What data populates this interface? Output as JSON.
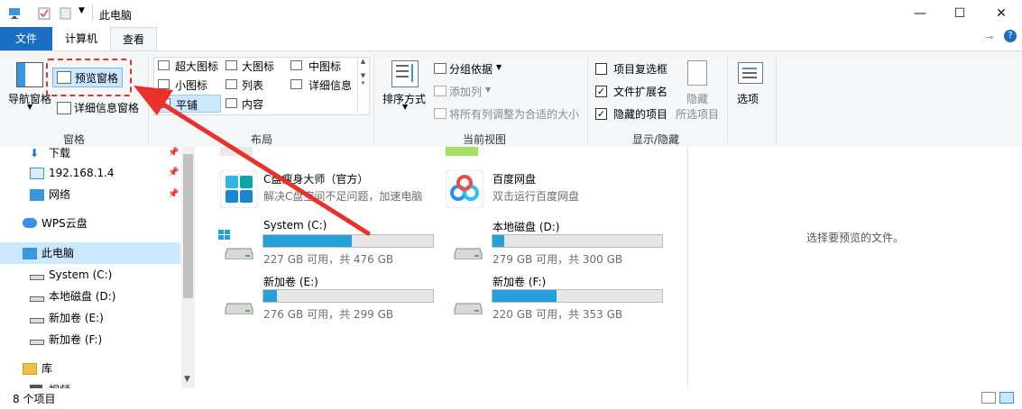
{
  "titlebar": {
    "title": "此电脑"
  },
  "tabs": {
    "file": "文件",
    "computer": "计算机",
    "view": "查看"
  },
  "ribbon": {
    "panes": {
      "nav_pane": "导航窗格",
      "preview_pane": "预览窗格",
      "details_pane": "详细信息窗格",
      "group": "窗格"
    },
    "layout": {
      "extra_large": "超大图标",
      "large": "大图标",
      "medium": "中图标",
      "small": "小图标",
      "list": "列表",
      "details": "详细信息",
      "tiles": "平铺",
      "content": "内容",
      "group": "布局"
    },
    "current_view": {
      "sort_by": "排序方式",
      "group_by": "分组依据",
      "add_columns": "添加列",
      "size_all_columns": "将所有列调整为合适的大小",
      "group": "当前视图"
    },
    "show_hide": {
      "item_checkboxes": "项目复选框",
      "file_extensions": "文件扩展名",
      "hidden_items": "隐藏的项目",
      "hide_selected": "隐藏",
      "selected_items": "所选项目",
      "group": "显示/隐藏"
    },
    "options": "选项",
    "checks": {
      "item_checkboxes": false,
      "file_extensions": true,
      "hidden_items": true
    }
  },
  "nav": {
    "items": [
      {
        "label": "下载"
      },
      {
        "label": "192.168.1.4"
      },
      {
        "label": "网络"
      },
      {
        "label": "WPS云盘"
      },
      {
        "label": "此电脑"
      },
      {
        "label": "System (C:)"
      },
      {
        "label": "本地磁盘 (D:)"
      },
      {
        "label": "新加卷 (E:)"
      },
      {
        "label": "新加卷 (F:)"
      },
      {
        "label": "库"
      },
      {
        "label": "视频"
      }
    ]
  },
  "apps": [
    {
      "name": "C盘瘦身大师（官方）",
      "desc": "解决C盘空间不足问题，加速电脑"
    },
    {
      "name": "百度网盘",
      "desc": "双击运行百度网盘"
    }
  ],
  "drives": [
    {
      "name": "System (C:)",
      "size": "227 GB 可用，共 476 GB",
      "used_fraction": 0.52
    },
    {
      "name": "本地磁盘 (D:)",
      "size": "279 GB 可用，共 300 GB",
      "used_fraction": 0.07
    },
    {
      "name": "新加卷 (E:)",
      "size": "276 GB 可用，共 299 GB",
      "used_fraction": 0.08
    },
    {
      "name": "新加卷 (F:)",
      "size": "220 GB 可用，共 353 GB",
      "used_fraction": 0.38
    }
  ],
  "preview": {
    "empty_text": "选择要预览的文件。"
  },
  "status": {
    "count": "8 个项目"
  },
  "colors": {
    "accent": "#1a6fc4",
    "bar_fill": "#26a0da",
    "annotation": "#e8312a"
  }
}
